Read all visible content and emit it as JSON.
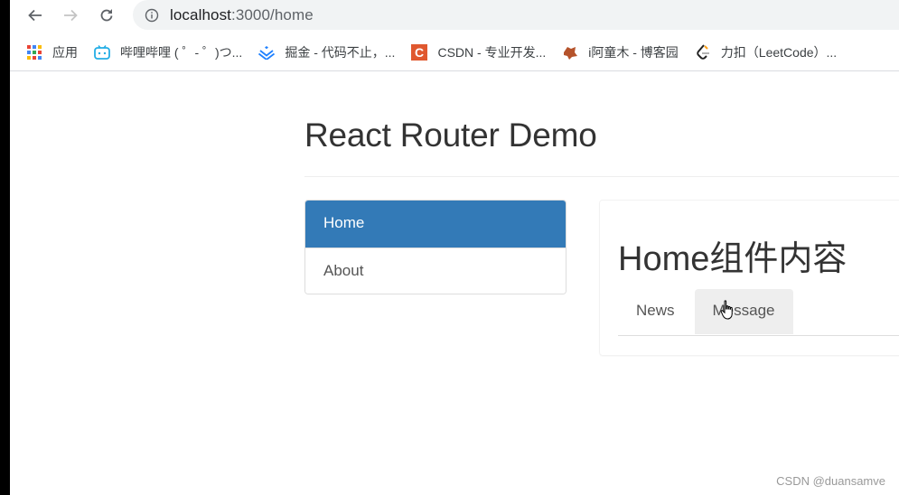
{
  "browser": {
    "url_host": "localhost",
    "url_path": ":3000/home",
    "nav": {
      "back_icon": "arrow-left-icon",
      "forward_icon": "arrow-right-icon",
      "reload_icon": "reload-icon",
      "info_icon": "info-circle-icon"
    },
    "bookmarks": [
      {
        "label": "应用",
        "icon": "apps-grid-icon"
      },
      {
        "label": "哔哩哔哩 ( ゜- ゜)つ...",
        "icon": "bilibili-icon"
      },
      {
        "label": "掘金 - 代码不止，...",
        "icon": "juejin-icon"
      },
      {
        "label": "CSDN - 专业开发...",
        "icon": "csdn-icon"
      },
      {
        "label": "i阿童木 - 博客园",
        "icon": "cnblogs-icon"
      },
      {
        "label": "力扣（LeetCode）...",
        "icon": "leetcode-icon"
      }
    ]
  },
  "page": {
    "title": "React Router Demo",
    "sidebar": {
      "items": [
        {
          "label": "Home",
          "active": true
        },
        {
          "label": "About",
          "active": false
        }
      ]
    },
    "content": {
      "heading": "Home组件内容",
      "tabs": [
        {
          "label": "News"
        },
        {
          "label": "Message"
        }
      ]
    }
  },
  "watermark": "CSDN @duansamve",
  "colors": {
    "primary": "#337ab7",
    "tab_hover": "#eeeeee",
    "text": "#333333"
  }
}
